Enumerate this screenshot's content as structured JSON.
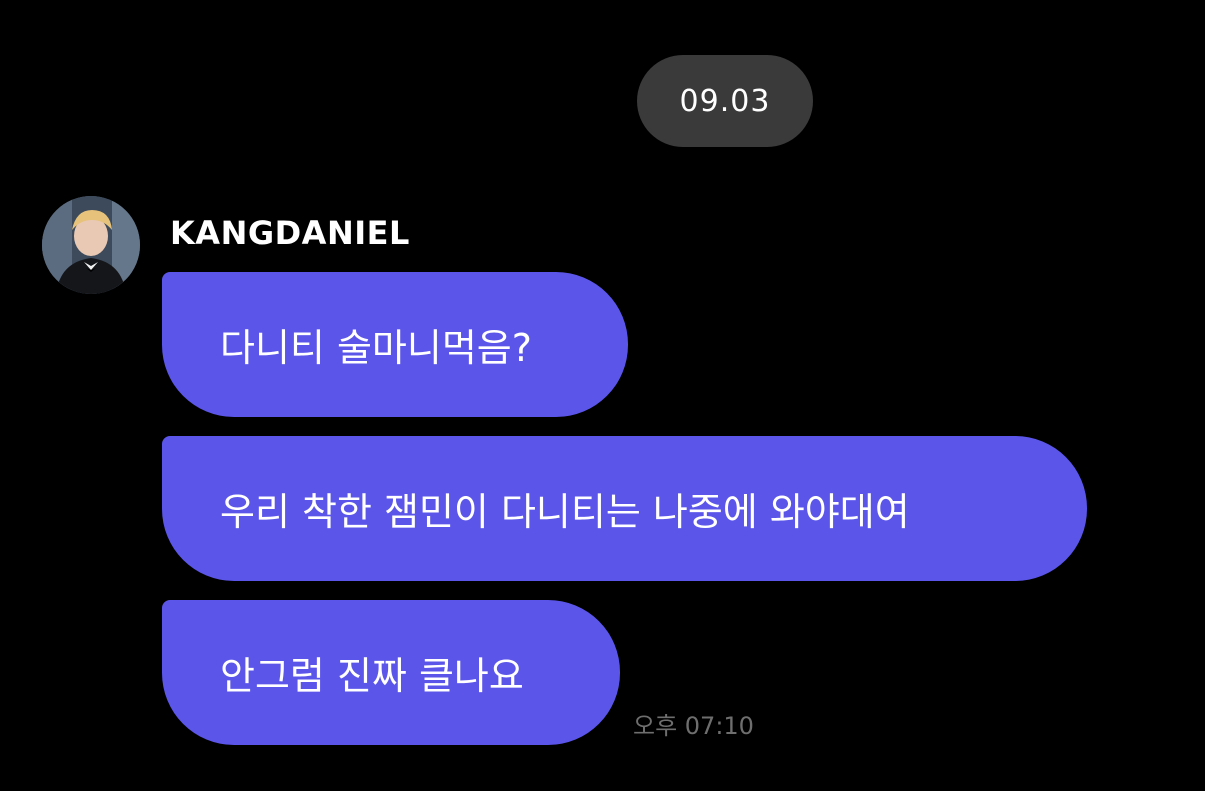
{
  "chat": {
    "date_label": "09.03",
    "sender": {
      "name": "KANGDANIEL",
      "avatar_icon": "profile-avatar"
    },
    "messages": [
      {
        "text": "다니티 술마니먹음?"
      },
      {
        "text": "우리 착한 잼민이 다니티는 나중에 와야대여"
      },
      {
        "text": "안그럼 진짜 클나요"
      }
    ],
    "timestamp": "오후 07:10",
    "colors": {
      "background": "#000000",
      "bubble": "#5b55ea",
      "date_pill": "#3a3a3a",
      "timestamp": "#6e6e6e"
    }
  }
}
